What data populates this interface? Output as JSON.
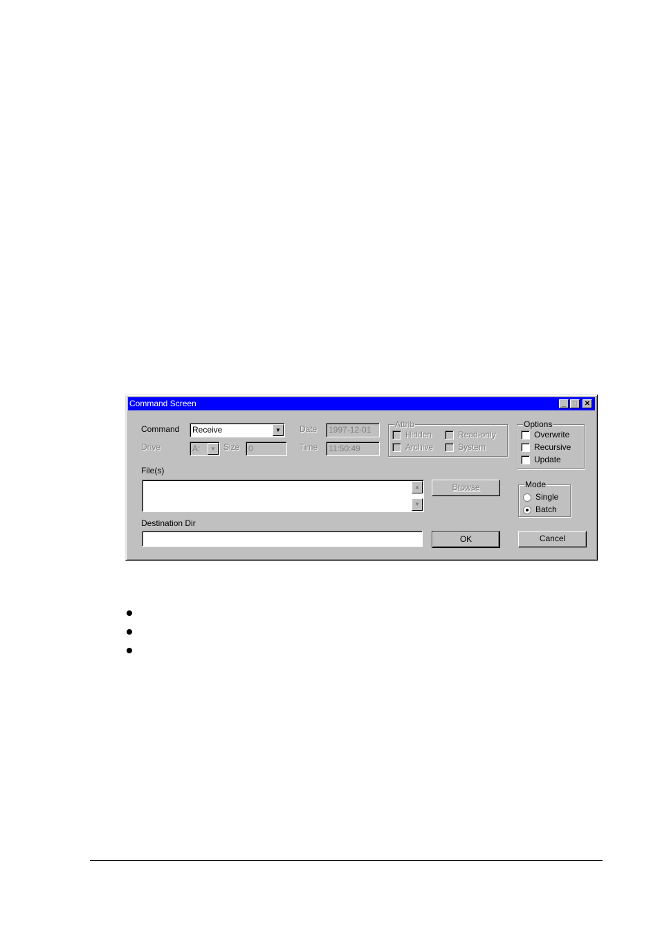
{
  "dialog": {
    "title": "Command Screen",
    "title_buttons": [
      {
        "name": "minimize",
        "glyph": "_"
      },
      {
        "name": "maximize",
        "glyph": "□"
      },
      {
        "name": "close",
        "glyph": "✕"
      }
    ],
    "command_label": "Command",
    "command_value": "Receive",
    "drive_label": "Drive",
    "drive_value": "A:",
    "size_label": "Size",
    "size_value": "0",
    "date_label": "Date",
    "date_value": "1997-12-01",
    "time_label": "Time",
    "time_value": "11:50:49",
    "attrib": {
      "caption": "Attrib",
      "items": [
        {
          "label": "Hidden",
          "checked": false
        },
        {
          "label": "Read-only",
          "checked": false
        },
        {
          "label": "Archive",
          "checked": false
        },
        {
          "label": "System",
          "checked": false
        }
      ]
    },
    "options": {
      "caption": "Options",
      "items": [
        {
          "label": "Overwrite",
          "checked": false
        },
        {
          "label": "Recursive",
          "checked": false
        },
        {
          "label": "Update",
          "checked": false
        }
      ]
    },
    "files_label": "File(s)",
    "files_value": "",
    "browse_label": "Browse",
    "mode": {
      "caption": "Mode",
      "items": [
        {
          "label": "Single",
          "selected": false
        },
        {
          "label": "Batch",
          "selected": true
        }
      ]
    },
    "dest_label": "Destination Dir",
    "dest_value": "",
    "ok_label": "OK",
    "cancel_label": "Cancel"
  },
  "bullets": [
    "",
    "",
    ""
  ]
}
